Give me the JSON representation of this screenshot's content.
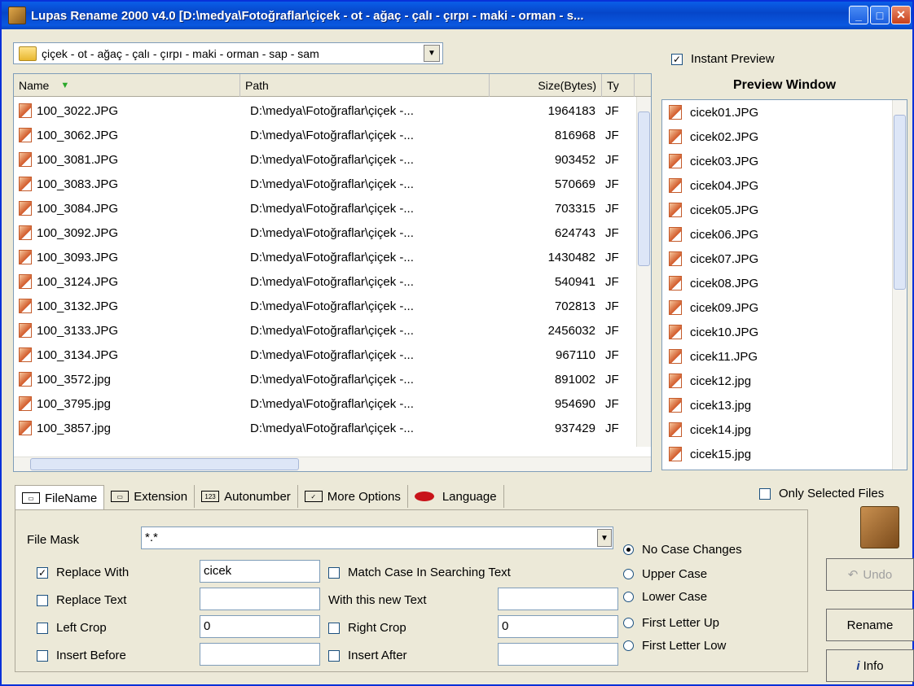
{
  "window": {
    "title": "Lupas Rename 2000 v4.0  [D:\\medya\\Fotoğraflar\\çiçek - ot - ağaç - çalı - çırpı - maki - orman - s..."
  },
  "folder_combo": {
    "value": "çiçek - ot - ağaç - çalı - çırpı - maki - orman - sap - sam"
  },
  "file_list": {
    "columns": [
      "Name",
      "Path",
      "Size(Bytes)",
      "Ty"
    ],
    "rows": [
      {
        "name": "100_3022.JPG",
        "path": "D:\\medya\\Fotoğraflar\\çiçek -...",
        "size": "1964183",
        "type": "JF"
      },
      {
        "name": "100_3062.JPG",
        "path": "D:\\medya\\Fotoğraflar\\çiçek -...",
        "size": "816968",
        "type": "JF"
      },
      {
        "name": "100_3081.JPG",
        "path": "D:\\medya\\Fotoğraflar\\çiçek -...",
        "size": "903452",
        "type": "JF"
      },
      {
        "name": "100_3083.JPG",
        "path": "D:\\medya\\Fotoğraflar\\çiçek -...",
        "size": "570669",
        "type": "JF"
      },
      {
        "name": "100_3084.JPG",
        "path": "D:\\medya\\Fotoğraflar\\çiçek -...",
        "size": "703315",
        "type": "JF"
      },
      {
        "name": "100_3092.JPG",
        "path": "D:\\medya\\Fotoğraflar\\çiçek -...",
        "size": "624743",
        "type": "JF"
      },
      {
        "name": "100_3093.JPG",
        "path": "D:\\medya\\Fotoğraflar\\çiçek -...",
        "size": "1430482",
        "type": "JF"
      },
      {
        "name": "100_3124.JPG",
        "path": "D:\\medya\\Fotoğraflar\\çiçek -...",
        "size": "540941",
        "type": "JF"
      },
      {
        "name": "100_3132.JPG",
        "path": "D:\\medya\\Fotoğraflar\\çiçek -...",
        "size": "702813",
        "type": "JF"
      },
      {
        "name": "100_3133.JPG",
        "path": "D:\\medya\\Fotoğraflar\\çiçek -...",
        "size": "2456032",
        "type": "JF"
      },
      {
        "name": "100_3134.JPG",
        "path": "D:\\medya\\Fotoğraflar\\çiçek -...",
        "size": "967110",
        "type": "JF"
      },
      {
        "name": "100_3572.jpg",
        "path": "D:\\medya\\Fotoğraflar\\çiçek -...",
        "size": "891002",
        "type": "JF"
      },
      {
        "name": "100_3795.jpg",
        "path": "D:\\medya\\Fotoğraflar\\çiçek -...",
        "size": "954690",
        "type": "JF"
      },
      {
        "name": "100_3857.jpg",
        "path": "D:\\medya\\Fotoğraflar\\çiçek -...",
        "size": "937429",
        "type": "JF"
      }
    ]
  },
  "preview": {
    "instant_label": "Instant Preview",
    "title": "Preview Window",
    "items": [
      "cicek01.JPG",
      "cicek02.JPG",
      "cicek03.JPG",
      "cicek04.JPG",
      "cicek05.JPG",
      "cicek06.JPG",
      "cicek07.JPG",
      "cicek08.JPG",
      "cicek09.JPG",
      "cicek10.JPG",
      "cicek11.JPG",
      "cicek12.jpg",
      "cicek13.jpg",
      "cicek14.jpg",
      "cicek15.jpg"
    ]
  },
  "tabs": [
    "FileName",
    "Extension",
    "Autonumber",
    "More Options",
    "Language"
  ],
  "only_selected_label": "Only Selected Files",
  "form": {
    "file_mask_label": "File Mask",
    "file_mask_value": "*.*",
    "replace_with_label": "Replace With",
    "replace_with_value": "cicek",
    "match_case_label": "Match Case In Searching Text",
    "replace_text_label": "Replace Text",
    "with_new_text_label": "With this new Text",
    "left_crop_label": "Left Crop",
    "left_crop_value": "0",
    "right_crop_label": "Right Crop",
    "right_crop_value": "0",
    "insert_before_label": "Insert Before",
    "insert_after_label": "Insert After"
  },
  "case_options": [
    "No Case Changes",
    "Upper Case",
    "Lower Case",
    "First Letter Up",
    "First Letter Low"
  ],
  "buttons": {
    "undo": "Undo",
    "rename": "Rename",
    "info": "Info"
  }
}
